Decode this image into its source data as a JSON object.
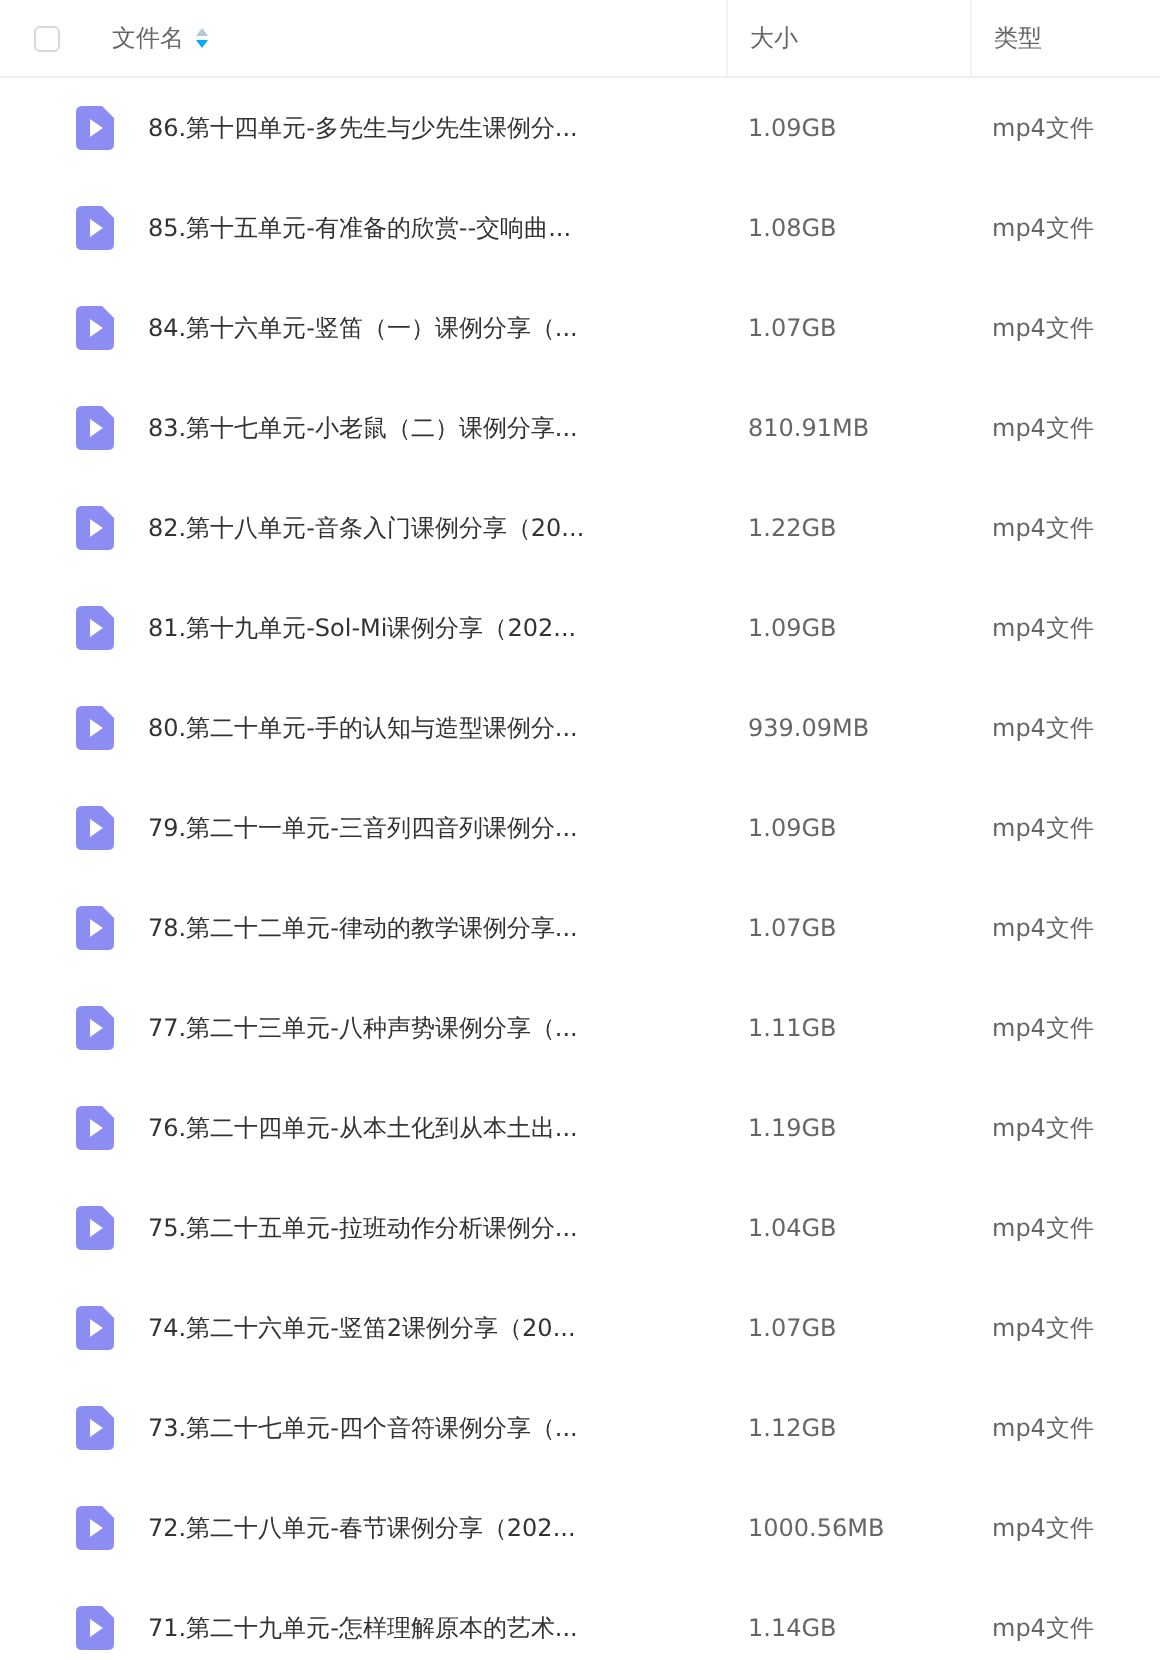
{
  "header": {
    "select_all": {
      "checked": false
    },
    "columns": [
      {
        "label": "文件名",
        "sortable": true
      },
      {
        "label": "大小",
        "sortable": false
      },
      {
        "label": "类型",
        "sortable": false
      }
    ]
  },
  "rows": [
    {
      "name": "86.第十四单元-多先生与少先生课例分...",
      "size": "1.09GB",
      "type": "mp4文件"
    },
    {
      "name": "85.第十五单元-有准备的欣赏--交响曲...",
      "size": "1.08GB",
      "type": "mp4文件"
    },
    {
      "name": "84.第十六单元-竖笛（一）课例分享（...",
      "size": "1.07GB",
      "type": "mp4文件"
    },
    {
      "name": "83.第十七单元-小老鼠（二）课例分享...",
      "size": "810.91MB",
      "type": "mp4文件"
    },
    {
      "name": "82.第十八单元-音条入门课例分享（20...",
      "size": "1.22GB",
      "type": "mp4文件"
    },
    {
      "name": "81.第十九单元-Sol-Mi课例分享（202...",
      "size": "1.09GB",
      "type": "mp4文件"
    },
    {
      "name": "80.第二十单元-手的认知与造型课例分...",
      "size": "939.09MB",
      "type": "mp4文件"
    },
    {
      "name": "79.第二十一单元-三音列四音列课例分...",
      "size": "1.09GB",
      "type": "mp4文件"
    },
    {
      "name": "78.第二十二单元-律动的教学课例分享...",
      "size": "1.07GB",
      "type": "mp4文件"
    },
    {
      "name": "77.第二十三单元-八种声势课例分享（...",
      "size": "1.11GB",
      "type": "mp4文件"
    },
    {
      "name": "76.第二十四单元-从本土化到从本土出...",
      "size": "1.19GB",
      "type": "mp4文件"
    },
    {
      "name": "75.第二十五单元-拉班动作分析课例分...",
      "size": "1.04GB",
      "type": "mp4文件"
    },
    {
      "name": "74.第二十六单元-竖笛2课例分享（20...",
      "size": "1.07GB",
      "type": "mp4文件"
    },
    {
      "name": "73.第二十七单元-四个音符课例分享（...",
      "size": "1.12GB",
      "type": "mp4文件"
    },
    {
      "name": "72.第二十八单元-春节课例分享（202...",
      "size": "1000.56MB",
      "type": "mp4文件"
    },
    {
      "name": "71.第二十九单元-怎样理解原本的艺术...",
      "size": "1.14GB",
      "type": "mp4文件"
    }
  ]
}
